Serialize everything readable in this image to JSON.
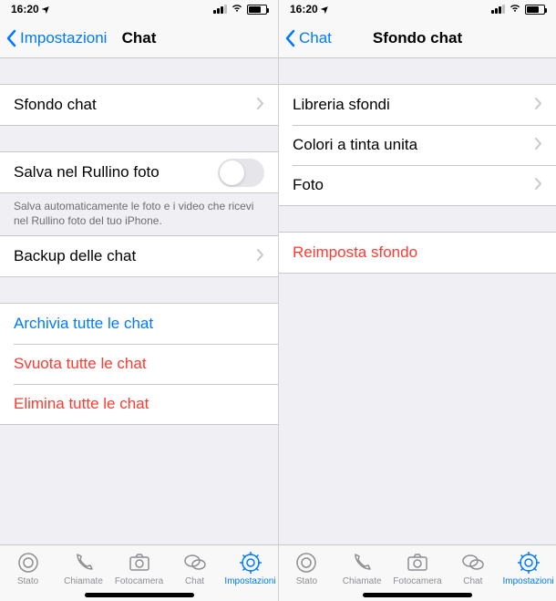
{
  "status": {
    "time": "16:20",
    "location_arrow": "➤"
  },
  "left": {
    "nav": {
      "back": "Impostazioni",
      "title": "Chat"
    },
    "row_sfondo": "Sfondo chat",
    "row_salva": "Salva nel Rullino foto",
    "footer_salva": "Salva automaticamente le foto e i video che ricevi nel Rullino foto del tuo iPhone.",
    "row_backup": "Backup delle chat",
    "row_archivia": "Archivia tutte le chat",
    "row_svuota": "Svuota tutte le chat",
    "row_elimina": "Elimina tutte le chat"
  },
  "right": {
    "nav": {
      "back": "Chat",
      "title": "Sfondo chat"
    },
    "row_libreria": "Libreria sfondi",
    "row_colori": "Colori a tinta unita",
    "row_foto": "Foto",
    "row_reimposta": "Reimposta sfondo"
  },
  "tabs": {
    "stato": "Stato",
    "chiamate": "Chiamate",
    "fotocamera": "Fotocamera",
    "chat": "Chat",
    "impostazioni": "Impostazioni"
  }
}
